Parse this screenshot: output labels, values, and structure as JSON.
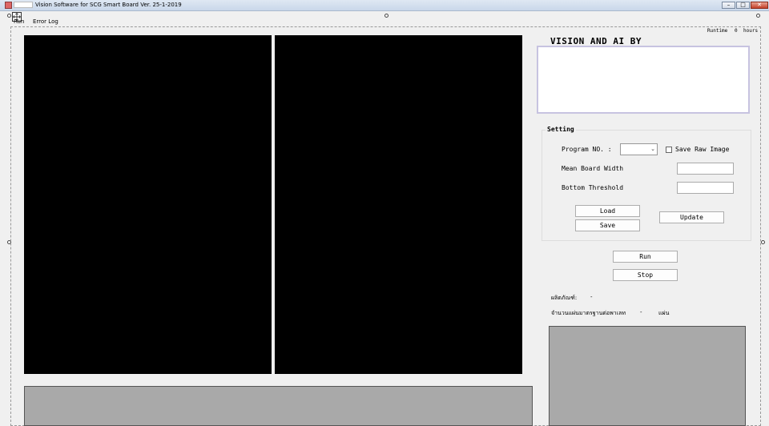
{
  "window": {
    "title": "Vision Software for SCG Smart Board Ver. 25-1-2019",
    "minimize_label": "–",
    "maximize_label": "□",
    "close_label": "✕"
  },
  "menu": {
    "items": [
      {
        "label": "Run"
      },
      {
        "label": "Error Log"
      }
    ]
  },
  "runtime": {
    "label": "Runtime",
    "value": "0",
    "unit": "hours"
  },
  "brand": {
    "text": "VISION AND AI BY"
  },
  "setting": {
    "title": "Setting",
    "program_no_label": "Program NO. :",
    "program_no_value": "",
    "save_raw_image_label": "Save Raw Image",
    "mean_board_width_label": "Mean Board Width",
    "mean_board_width_value": "",
    "bottom_threshold_label": "Bottom Threshold",
    "bottom_threshold_value": "",
    "load_label": "Load",
    "save_label": "Save",
    "update_label": "Update"
  },
  "controls": {
    "run_label": "Run",
    "stop_label": "Stop"
  },
  "product": {
    "label": "ผลิตภัณฑ์:",
    "value": "-",
    "count_label": "จำนวนแผ่นมาตรฐานต่อพาเลท",
    "count_value": "-",
    "count_unit": "แผ่น"
  },
  "colors": {
    "video_background": "#000000",
    "placeholder_gray": "#a9a9a9",
    "logo_border": "#c7c3e0"
  }
}
